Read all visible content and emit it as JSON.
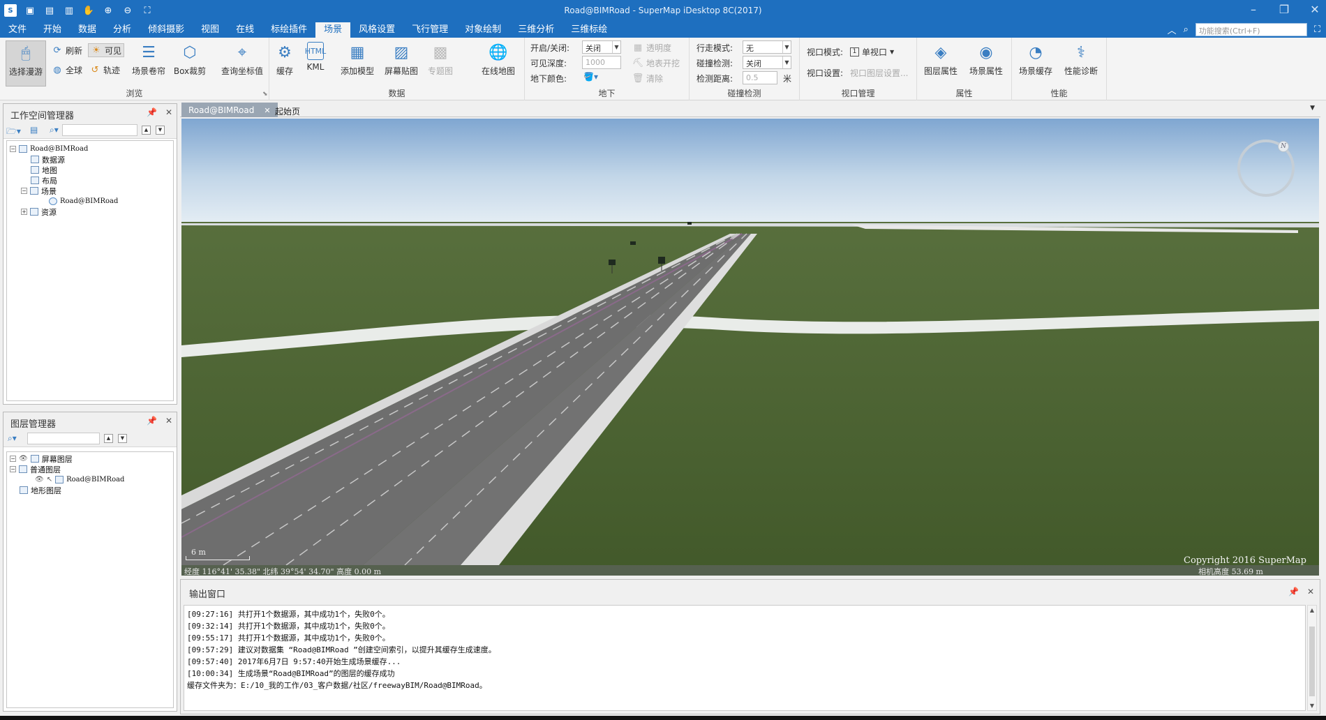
{
  "window": {
    "title": "Road@BIMRoad - SuperMap iDesktop 8C(2017)",
    "app_icon": "supermap-logo",
    "quick_access_icons": [
      "save-icon",
      "new-icon",
      "open-icon",
      "pan-icon",
      "zoom-in-icon",
      "zoom-out-icon",
      "full-extent-icon"
    ]
  },
  "menu": {
    "tabs": [
      "文件",
      "开始",
      "数据",
      "分析",
      "倾斜摄影",
      "视图",
      "在线",
      "标绘插件",
      "场景",
      "风格设置",
      "飞行管理",
      "对象绘制",
      "三维分析",
      "三维标绘"
    ],
    "active_tab": "场景",
    "search_placeholder": "功能搜索(Ctrl+F)"
  },
  "ribbon": {
    "browse": {
      "label": "浏览",
      "select_roam": "选择漫游",
      "refresh": "刷新",
      "visible": "可见",
      "full_extent": "全球",
      "track": "轨迹",
      "scene_shutter": "场景卷帘",
      "box_clip": "Box裁剪",
      "query_coords": "查询坐标值"
    },
    "data": {
      "label": "数据",
      "cache": "缓存",
      "kml": "KML",
      "add_model": "添加模型",
      "screen_texture": "屏幕贴图",
      "thematic": "专题图",
      "online_map": "在线地图"
    },
    "underground": {
      "label": "地下",
      "toggle_label": "开启/关闭:",
      "toggle_value": "关闭",
      "depth_label": "可见深度:",
      "depth_value": "1000",
      "color_label": "地下颜色:",
      "transparency": "透明度",
      "surface_dig": "地表开挖",
      "clear": "清除"
    },
    "collision": {
      "label": "碰撞检测",
      "walk_mode_label": "行走模式:",
      "walk_mode_value": "无",
      "collision_label": "碰撞检测:",
      "collision_value": "关闭",
      "distance_label": "检测距离:",
      "distance_value": "0.5",
      "distance_unit": "米"
    },
    "viewport": {
      "label": "视口管理",
      "mode_label": "视口模式:",
      "mode_value": "单视口",
      "setting_label": "视口设置:",
      "setting_value": "视口图层设置..."
    },
    "properties": {
      "label": "属性",
      "layer_props": "图层属性",
      "scene_props": "场景属性"
    },
    "performance": {
      "label": "性能",
      "scene_cache": "场景缓存",
      "diagnose": "性能诊断"
    }
  },
  "workspace_panel": {
    "title": "工作空间管理器",
    "tree": [
      {
        "label": "Road@BIMRoad"
      },
      {
        "label": "数据源"
      },
      {
        "label": "地图"
      },
      {
        "label": "布局"
      },
      {
        "label": "场景"
      },
      {
        "label": "Road@BIMRoad"
      },
      {
        "label": "资源"
      }
    ]
  },
  "layer_panel": {
    "title": "图层管理器",
    "tree": [
      {
        "label": "屏幕图层"
      },
      {
        "label": "普通图层"
      },
      {
        "label": "Road@BIMRoad"
      },
      {
        "label": "地形图层"
      }
    ]
  },
  "doc_tabs": [
    "Road@BIMRoad",
    "起始页"
  ],
  "scene": {
    "copyright": "Copyright 2016 SuperMap",
    "coords": "经度 116°41' 35.38\"   北纬 39°54' 34.70\"   高度 0.00 m",
    "camera_height": "相机高度 53.69 m",
    "scale_label": "6 m",
    "compass_label": "N",
    "colors": {
      "sky_top": "#7fa6d1",
      "sky_bottom": "#e4edf4",
      "grass": "#49632f",
      "road": "#6e6e6e"
    }
  },
  "output": {
    "title": "输出窗口",
    "lines": [
      "[09:27:16] 共打开1个数据源，其中成功1个，失败0个。",
      "[09:32:14] 共打开1个数据源，其中成功1个，失败0个。",
      "[09:55:17] 共打开1个数据源，其中成功1个，失败0个。",
      "[09:57:29] 建议对数据集 “Road@BIMRoad ”创建空间索引，以提升其缓存生成速度。",
      "[09:57:40] 2017年6月7日 9:57:40开始生成场景缓存...",
      "[10:00:34] 生成场景“Road@BIMRoad”的图层的缓存成功",
      "缓存文件夹为：E:/10_我的工作/03_客户数据/社区/freewayBIM/Road@BIMRoad。"
    ]
  }
}
